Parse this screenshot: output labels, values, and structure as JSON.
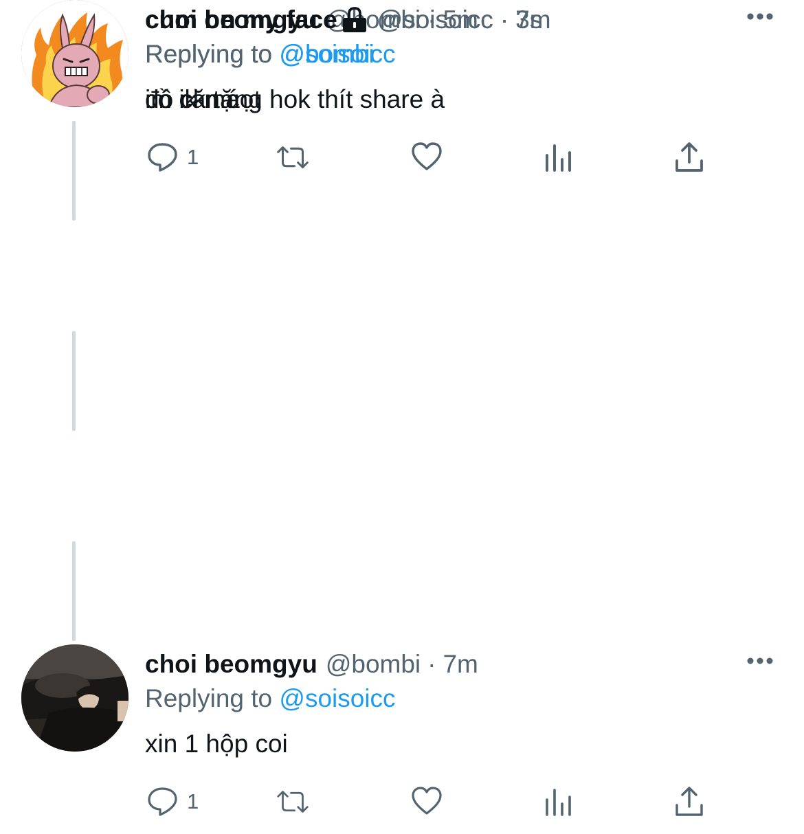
{
  "colors": {
    "text_primary": "#0f1419",
    "text_secondary": "#536471",
    "link": "#1d9bf0",
    "thread_line": "#cfd9de"
  },
  "icons": {
    "reply": "reply-icon",
    "retweet": "retweet-icon",
    "like": "heart-icon",
    "analytics": "analytics-icon",
    "share": "share-icon",
    "more": "more-icon",
    "lock": "lock-icon"
  },
  "tweets": [
    {
      "display_name": "choi beomgyu",
      "handle": "@bombi",
      "separator": "·",
      "time": "7m",
      "reply_prefix": "Replying to",
      "reply_to": "@soisoicc",
      "text": "xin 1 hộp coi",
      "reply_count": "1",
      "protected": false
    },
    {
      "display_name": "cum on my face",
      "handle": "@soisoicc",
      "separator": "·",
      "time": "7m",
      "reply_prefix": "Replying to",
      "reply_to": "@bombi",
      "text": "có căn cọt",
      "reply_count": "1",
      "protected": true
    },
    {
      "display_name": "choi beomgyu",
      "handle": "@bombi",
      "separator": "·",
      "time": "5m",
      "reply_prefix": "Replying to",
      "reply_to": "@soisoicc",
      "text": "đồ ck tặng hok thít share à",
      "reply_count": "1",
      "protected": false
    },
    {
      "display_name": "cum on my face",
      "handle": "@soisoicc",
      "separator": "·",
      "time": "3s",
      "reply_prefix": "Replying to",
      "reply_to": "@bombi",
      "text": "im ik má",
      "reply_count": "",
      "protected": true
    }
  ]
}
